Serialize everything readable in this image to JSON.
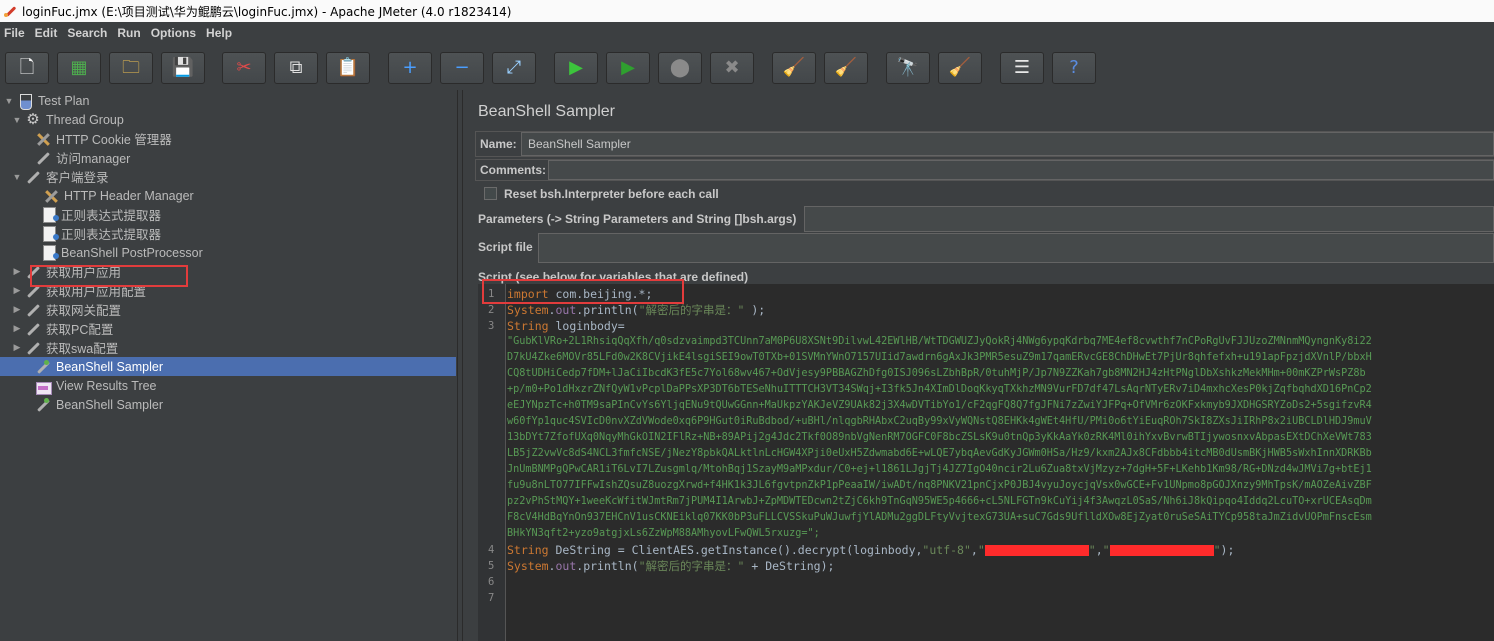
{
  "window": {
    "title": "loginFuc.jmx (E:\\项目测试\\华为鲲鹏云\\loginFuc.jmx) - Apache JMeter (4.0 r1823414)"
  },
  "menu": [
    "File",
    "Edit",
    "Search",
    "Run",
    "Options",
    "Help"
  ],
  "toolbar": [
    {
      "name": "new-plan-button",
      "glyph": "🗋",
      "color": "#f4f4f4"
    },
    {
      "name": "templates-button",
      "glyph": "▦",
      "color": "#4eae4e"
    },
    {
      "name": "open-button",
      "glyph": "🗀",
      "color": "#f2c14e"
    },
    {
      "name": "save-button",
      "glyph": "💾",
      "color": "#dcdcdc"
    },
    {
      "name": "cut-button",
      "glyph": "✂",
      "color": "#e04a4a"
    },
    {
      "name": "copy-button",
      "glyph": "⧉",
      "color": "#e0e0e0"
    },
    {
      "name": "paste-button",
      "glyph": "📋",
      "color": "#e0c080"
    },
    {
      "name": "expand-button",
      "glyph": "+",
      "color": "#4a9eff"
    },
    {
      "name": "collapse-button",
      "glyph": "−",
      "color": "#4a9eff"
    },
    {
      "name": "toggle-button",
      "glyph": "⤢",
      "color": "#9ad0ff"
    },
    {
      "name": "start-button",
      "glyph": "▶",
      "color": "#3cc43c"
    },
    {
      "name": "start-no-pauses-button",
      "glyph": "▶",
      "color": "#2fa02f"
    },
    {
      "name": "stop-button",
      "glyph": "⬤",
      "color": "#8a8a8a"
    },
    {
      "name": "shutdown-button",
      "glyph": "✖",
      "color": "#8a8a8a"
    },
    {
      "name": "clear-button",
      "glyph": "🧹",
      "color": "#c8a070"
    },
    {
      "name": "clear-all-button",
      "glyph": "🧹",
      "color": "#b08050"
    },
    {
      "name": "search-button",
      "glyph": "🔭",
      "color": "#d0d0d0"
    },
    {
      "name": "reset-search-button",
      "glyph": "🧹",
      "color": "#f0d030"
    },
    {
      "name": "function-helper-button",
      "glyph": "☰",
      "color": "#e8e8e8"
    },
    {
      "name": "help-button",
      "glyph": "?",
      "color": "#5a8ce0"
    }
  ],
  "tree": [
    {
      "label": "Test Plan",
      "arrow": "▼",
      "icon": "flask"
    },
    {
      "label": "Thread Group",
      "arrow": "▼",
      "icon": "gear"
    },
    {
      "label": "HTTP Cookie 管理器",
      "arrow": "",
      "icon": "tools"
    },
    {
      "label": "访问manager",
      "arrow": "",
      "icon": "pipette"
    },
    {
      "label": "客户端登录",
      "arrow": "▼",
      "icon": "pipette"
    },
    {
      "label": "HTTP Header Manager",
      "arrow": "",
      "icon": "tools"
    },
    {
      "label": "正则表达式提取器",
      "arrow": "",
      "icon": "doc"
    },
    {
      "label": "正则表达式提取器",
      "arrow": "",
      "icon": "doc"
    },
    {
      "label": "BeanShell PostProcessor",
      "arrow": "",
      "icon": "doc"
    },
    {
      "label": "获取用户应用",
      "arrow": "▶",
      "icon": "pipette"
    },
    {
      "label": "获取用户应用配置",
      "arrow": "▶",
      "icon": "pipette"
    },
    {
      "label": "获取网关配置",
      "arrow": "▶",
      "icon": "pipette"
    },
    {
      "label": "获取PC配置",
      "arrow": "▶",
      "icon": "pipette"
    },
    {
      "label": "获取swa配置",
      "arrow": "▶",
      "icon": "pipette"
    },
    {
      "label": "BeanShell Sampler",
      "arrow": "",
      "icon": "pipette-green"
    },
    {
      "label": "View Results Tree",
      "arrow": "",
      "icon": "chart"
    },
    {
      "label": "BeanShell Sampler",
      "arrow": "",
      "icon": "pipette-green"
    }
  ],
  "panel": {
    "title": "BeanShell Sampler",
    "name_label": "Name:",
    "name_value": "BeanShell Sampler",
    "comments_label": "Comments:",
    "reset_label": "Reset bsh.Interpreter before each call",
    "params_label": "Parameters (-> String Parameters and String []bsh.args)",
    "script_file_label": "Script file",
    "script_label": "Script (see below for variables that are defined)"
  },
  "code": {
    "line_numbers": [
      "1",
      "2",
      "3",
      "4",
      "5",
      "6",
      "7"
    ],
    "l1_kw": "import",
    "l1_rest": " com.beijing.*;",
    "l2_obj": "System",
    "l2_out": "out",
    "l2_call": ".println(",
    "l2_str": "\"解密后的字串是：\"",
    "l2_end": " );",
    "l3_type": "String",
    "l3_rest": " loginbody=",
    "body_lines": [
      "\"GubKlVRo+2L1RhsiqQqXfh/q0sdzvaimpd3TCUnn7aM0P6U8XSNt9DilvwL42EWlHB/WtTDGWUZJyQokRj4NWg6ypqKdrbq7ME4ef8cvwthf7nCPoRgUvFJJUzoZMNnmMQyngnKy8i22",
      "D7kU4Zke6MOVr85LFd0w2K8CVjikE4lsgiSEI9owT0TXb+01SVMnYWnO7157UIid7awdrn6gAxJk3PMR5esuZ9m17qamERvcGE8ChDHwEt7PjUr8qhfefxh+u191apFpzjdXVnlP/bbxH",
      "CQ8tUDHiCedp7fDM+lJaCiIbcdK3fE5c7Yol68wv467+OdVjesy9PBBAGZhDfg0ISJ096sLZbhBpR/0tuhMjP/Jp7N9ZZKah7gb8MN2HJ4zHtPNglDbXshkzMekMHm+00mKZPrWsPZ8b",
      "+p/m0+Po1dHxzrZNfQyW1vPcplDaPPsXP3DT6bTESeNhuITTTCH3VT34SWqj+I3fk5Jn4XImDlDoqKkyqTXkhzMN9VurFD7df47LsAqrNTyERv7iD4mxhcXesP0kjZqfbqhdXD16PnCp2",
      "eEJYNpzTc+h0TM9saPInCvYs6YljqENu9tQUwGGnn+MaUkpzYAKJeVZ9UAk82j3X4wDVTibYo1/cF2qgFQ8Q7fgJFNi7zZwiYJFPq+OfVMr6zOKFxkmyb9JXDHGSRYZoDs2+5sgifzvR4",
      "w60fYp1quc4SVIcD0nvXZdVWode0xq6P9HGut0iRuBdbod/+uBHl/nlqgbRHAbxC2uqBy99xVyWQNstQ8EHKk4gWEt4HfU/PMi0o6tYiEuqROh7SkI8ZXsJiIRhP8x2iUBCLDlHDJ9muV",
      "13bDYt7ZfofUXq0NqyMhGkOIN2IFlRz+NB+89APij2g4Jdc2Tkf0O89nbVgNenRM7OGFC0F8bcZSLsK9u0tnQp3yKkAaYk0zRK4Ml0ihYxvBvrwBTIjywosnxvAbpasEXtDChXeVWt783",
      "LB5jZ2vwVc8dS4NCL3fmfcNSE/jNezY8pbkQALktlnLcHGW4XPji0eUxH5Zdwmabd6E+wLQE7ybqAevGdKyJGWm0HSa/Hz9/kxm2AJx8CFdbbb4itcMB0dUsmBKjHWB5sWxhInnXDRKBb",
      "JnUmBNMPgQPwCAR1iT6LvI7LZusgmlq/MtohBqj1SzayM9aMPxdur/C0+ej+l1861LJgjTj4JZ7IgO40ncir2Lu6Zua8txVjMzyz+7dgH+5F+LKehb1Km98/RG+DNzd4wJMVi7g+btEj1",
      "fu9u8nLTO77IFFwIshZQsuZ8uozgXrwd+f4HK1k3JL6fgvtpnZkP1pPeaaIW/iwADt/nq8PNKV21pnCjxP0JBJ4vyuJoycjqVsx0wGCE+Fv1UNpmo8pGOJXnzy9MhTpsK/mAOZeAivZBF",
      "pz2vPhStMQY+1weeKcWfitWJmtRm7jPUM4I1ArwbJ+ZpMDWTEDcwn2tZjC6kh9TnGqN95WE5p4666+cL5NLFGTn9kCuYij4f3AwqzL0SaS/Nh6iJ8kQipqo4Iddq2LcuTO+xrUCEAsqDm",
      "F8cV4HdBqYnOn937EHCnV1usCKNEiklq07KK0bP3uFLLCVSSkuPuWJuwfjYlADMu2ggDLFtyVvjtexG73UA+suC7Gds9UflldXOw8EjZyat0ruSeSAiTYCp958taJmZidvUOPmFnscEsm",
      "BHkYN3qft2+yzo9atgjxLs6ZzWpM88AMhyovLFwQWL5rxuzg=\";"
    ],
    "l4_type": "String",
    "l4_mid": " DeString = ClientAES.getInstance().decrypt(loginbody,",
    "l4_str1": "\"utf-8\"",
    "l4_comma": ",",
    "l4_str2a": "\"",
    "l4_str2b": "\"",
    "l4_comma2": ",",
    "l4_str3a": "\"",
    "l4_str3b": "\"",
    "l4_end": ");",
    "l5_obj": "System",
    "l5_out": "out",
    "l5_call": ".println(",
    "l5_str": "\"解密后的字串是：\"",
    "l5_end": " + DeString);"
  }
}
